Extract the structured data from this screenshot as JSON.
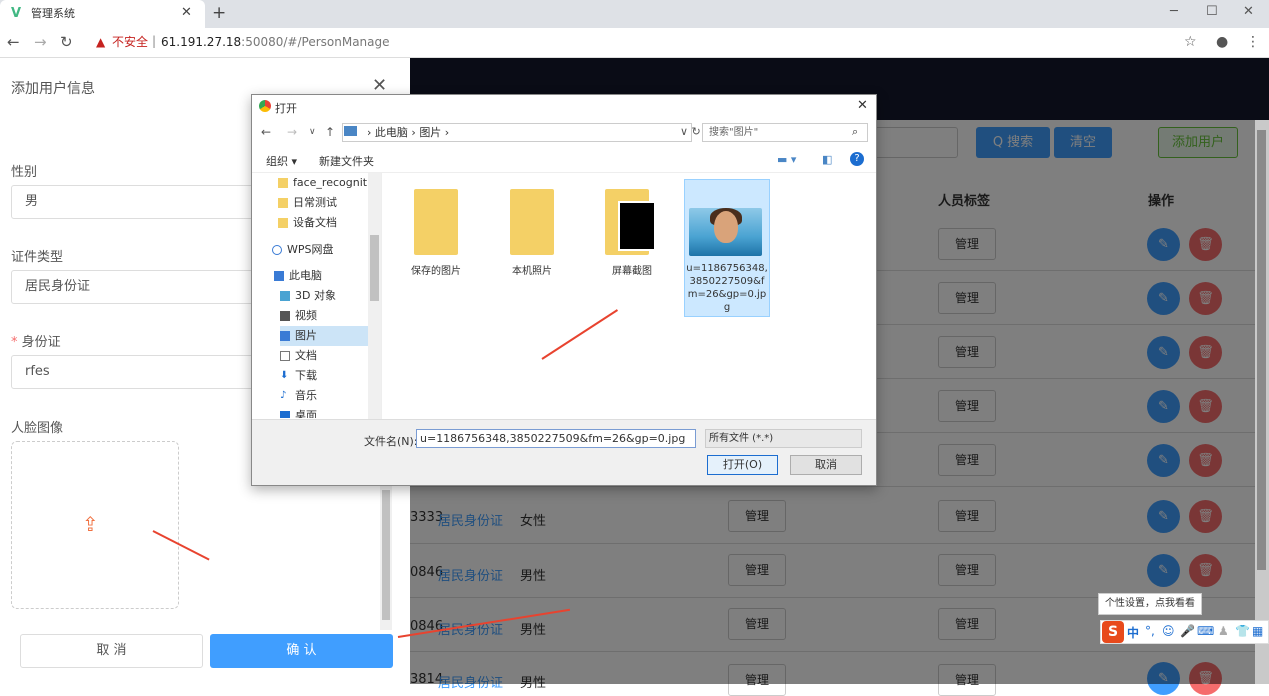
{
  "browser": {
    "tab_title": "管理系统",
    "tab_logo": "V",
    "insecure_label": "不安全",
    "url_host": "61.191.27.18",
    "url_rest": ":50080/#/PersonManage"
  },
  "toolbar": {
    "search_label": "Q 搜索",
    "clear_label": "清空",
    "add_user_label": "添加用户"
  },
  "table": {
    "headers": [
      "人员标签",
      "操作"
    ],
    "manage_label": "管理",
    "rows": [
      {
        "id_suffix": "3333",
        "id_type": "居民身份证",
        "gender": "女性"
      },
      {
        "id_suffix": "0846",
        "id_type": "居民身份证",
        "gender": "男性"
      },
      {
        "id_suffix": "0846",
        "id_type": "居民身份证",
        "gender": "男性"
      },
      {
        "id_suffix": "3814",
        "id_type": "居民身份证",
        "gender": "男性"
      }
    ]
  },
  "drawer": {
    "title": "添加用户信息",
    "gender_label": "性别",
    "gender_value": "男",
    "idtype_label": "证件类型",
    "idtype_value": "居民身份证",
    "id_label": "身份证",
    "id_value": "rfes",
    "face_label": "人脸图像",
    "cancel_label": "取 消",
    "confirm_label": "确 认"
  },
  "dialog": {
    "title": "打开",
    "path": [
      "此电脑",
      "图片"
    ],
    "search_placeholder": "搜索\"图片\"",
    "organize_label": "组织 ▾",
    "new_folder_label": "新建文件夹",
    "nav_items": [
      {
        "label": "face_recognitic",
        "icon": "folder-icon"
      },
      {
        "label": "日常测试",
        "icon": "folder-icon"
      },
      {
        "label": "设备文档",
        "icon": "folder-icon"
      },
      {
        "label": "WPS网盘",
        "icon": "cloud-icon"
      },
      {
        "label": "此电脑",
        "icon": "computer-icon"
      },
      {
        "label": "3D 对象",
        "icon": "cube-icon"
      },
      {
        "label": "视频",
        "icon": "video-icon"
      },
      {
        "label": "图片",
        "icon": "picture-icon",
        "selected": true
      },
      {
        "label": "文档",
        "icon": "document-icon"
      },
      {
        "label": "下载",
        "icon": "download-icon"
      },
      {
        "label": "音乐",
        "icon": "music-icon"
      },
      {
        "label": "桌面",
        "icon": "desktop-icon"
      }
    ],
    "folders": [
      "保存的图片",
      "本机照片",
      "屏幕截图"
    ],
    "selected_file": "u=1186756348,3850227509&fm=26&gp=0.jpg",
    "filename_label": "文件名(N):",
    "filename_value": "u=1186756348,3850227509&fm=26&gp=0.jpg",
    "filetype_value": "所有文件 (*.*)",
    "open_label": "打开(O)",
    "cancel_label": "取消"
  },
  "ime": {
    "tooltip": "个性设置，点我看看",
    "logo": "S",
    "mode": "中"
  },
  "colors": {
    "primary": "#409eff",
    "danger": "#f56c6c",
    "success": "#67c23a",
    "nav_dark": "#14192c"
  }
}
